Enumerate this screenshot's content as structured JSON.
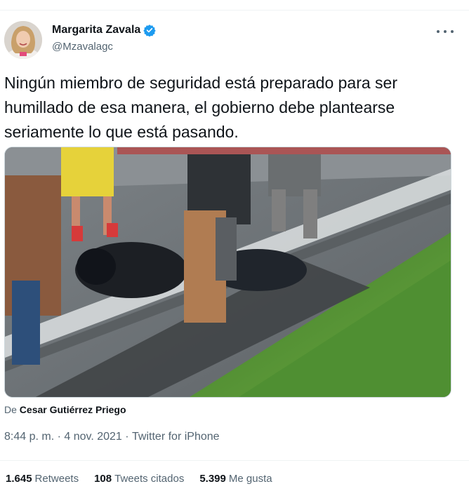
{
  "author": {
    "display_name": "Margarita Zavala",
    "handle": "@Mzavalagc"
  },
  "icons": {
    "verified": "verified-badge-icon",
    "more": "more-options-icon"
  },
  "colors": {
    "verified": "#1d9bf0",
    "text_primary": "#0f1419",
    "text_secondary": "#536471"
  },
  "tweet": {
    "text": "Ningún miembro de seguridad está preparado para ser humillado de esa manera, el gobierno debe plantearse seriamente lo que está pasando."
  },
  "attribution": {
    "prefix": "De",
    "author": "Cesar Gutiérrez Priego"
  },
  "meta": {
    "time": "8:44 p. m.",
    "separator": " · ",
    "date": "4 nov. 2021",
    "source": "Twitter for iPhone"
  },
  "stats": [
    {
      "count": "1.645",
      "label": "Retweets"
    },
    {
      "count": "108",
      "label": "Tweets citados"
    },
    {
      "count": "5.399",
      "label": "Me gusta"
    }
  ]
}
